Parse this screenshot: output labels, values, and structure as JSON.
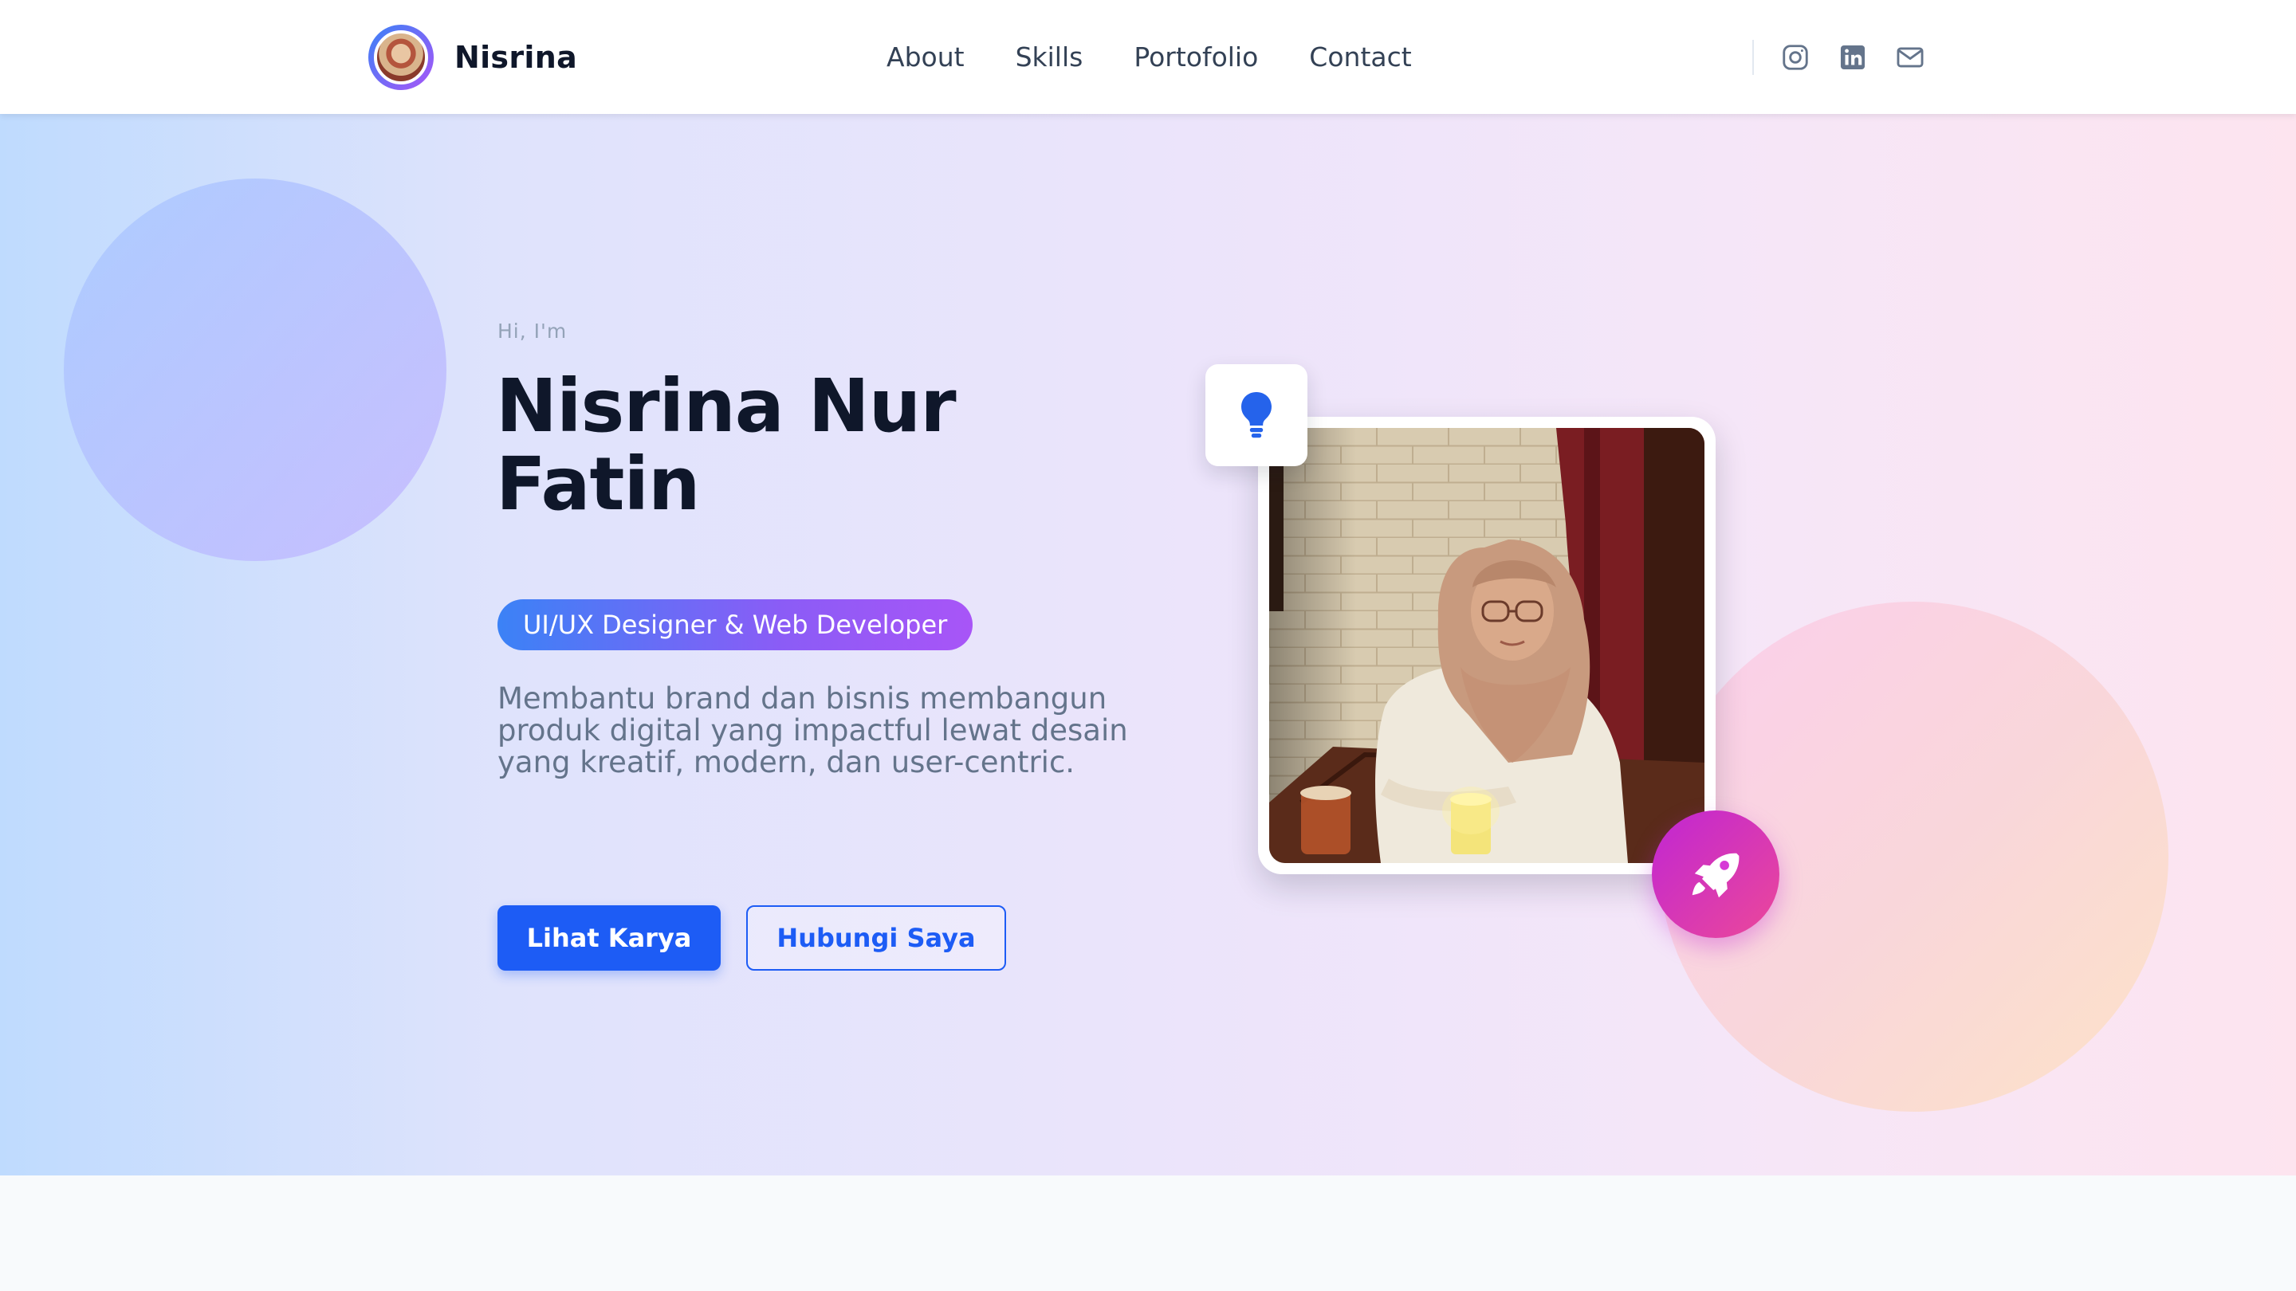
{
  "nav": {
    "brand": "Nisrina",
    "links": [
      "About",
      "Skills",
      "Portofolio",
      "Contact"
    ],
    "social": [
      {
        "icon": "instagram-icon"
      },
      {
        "icon": "linkedin-icon"
      },
      {
        "icon": "mail-icon"
      }
    ]
  },
  "hero": {
    "greeting": "Hi, I'm",
    "name": "Nisrina Nur Fatin",
    "role": "UI/UX Designer & Web Developer",
    "description": "Membantu brand dan bisnis membangun produk digital yang impactful lewat desain yang kreatif, modern, dan user-centric.",
    "primary_button": "Lihat Karya",
    "secondary_button": "Hubungi Saya"
  },
  "colors": {
    "accent": "#1d5cf5",
    "pill_gradient_start": "#3b82f6",
    "pill_gradient_end": "#a855f7",
    "rocket_gradient_start": "#c026d3",
    "rocket_gradient_end": "#ec4899"
  }
}
